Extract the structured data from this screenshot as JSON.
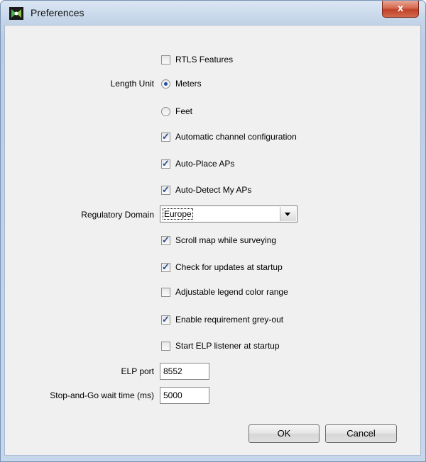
{
  "window": {
    "title": "Preferences",
    "close_label": "x"
  },
  "rtls": {
    "label": "RTLS Features",
    "checked": false
  },
  "length_unit": {
    "label": "Length Unit",
    "options": [
      {
        "label": "Meters",
        "selected": true
      },
      {
        "label": "Feet",
        "selected": false
      }
    ]
  },
  "auto_channel": {
    "label": "Automatic channel configuration",
    "checked": true
  },
  "auto_place": {
    "label": "Auto-Place APs",
    "checked": true
  },
  "auto_detect": {
    "label": "Auto-Detect My APs",
    "checked": true
  },
  "regulatory": {
    "label": "Regulatory Domain",
    "value": "Europe"
  },
  "scroll_map": {
    "label": "Scroll map while surveying",
    "checked": true
  },
  "check_updates": {
    "label": "Check for updates at startup",
    "checked": true
  },
  "legend_range": {
    "label": "Adjustable legend color range",
    "checked": false
  },
  "grey_out": {
    "label": "Enable requirement grey-out",
    "checked": true
  },
  "elp_listener": {
    "label": "Start ELP listener at startup",
    "checked": false
  },
  "elp_port": {
    "label": "ELP port",
    "value": "8552"
  },
  "stop_go": {
    "label": "Stop-and-Go wait time (ms)",
    "value": "5000"
  },
  "buttons": {
    "ok": "OK",
    "cancel": "Cancel"
  }
}
